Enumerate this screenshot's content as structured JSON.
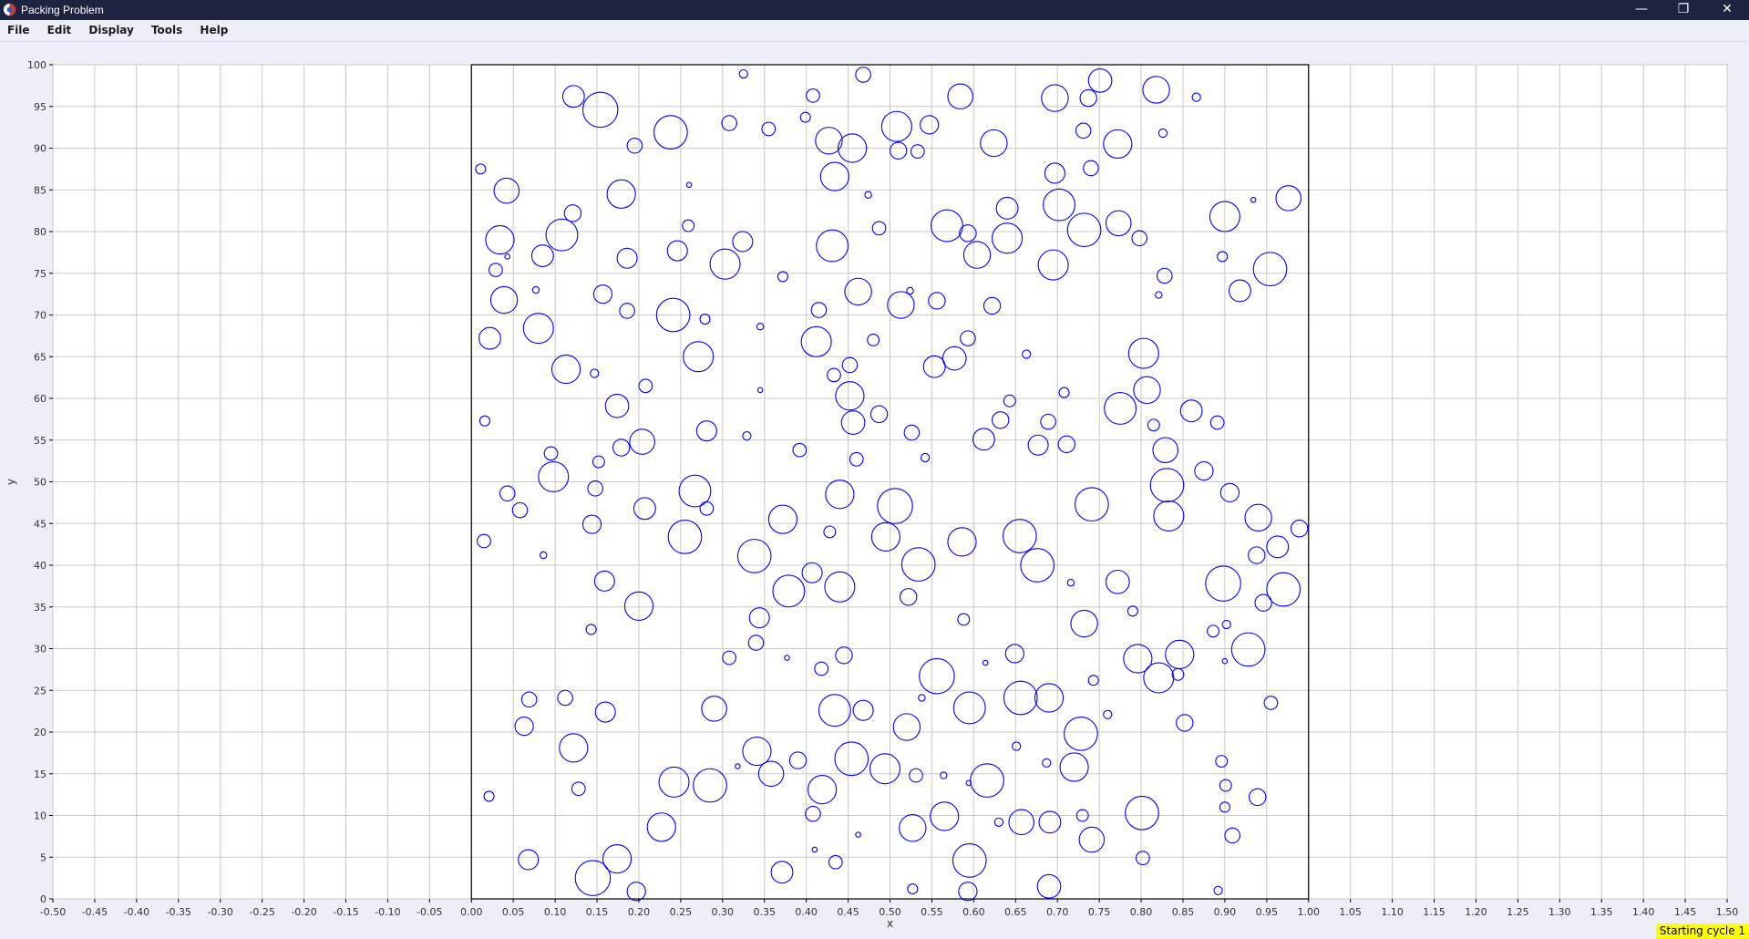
{
  "window": {
    "title": "Packing Problem",
    "minimize_label": "—",
    "restore_label": "❐",
    "close_label": "✕",
    "titlebar_color": "#1c2440"
  },
  "menu": {
    "file": "File",
    "edit": "Edit",
    "display": "Display",
    "tools": "Tools",
    "help": "Help"
  },
  "status": {
    "text": "Starting cycle 1"
  },
  "chart_data": {
    "type": "scatter",
    "xlabel": "x",
    "ylabel": "y",
    "xlim": [
      -0.5,
      1.5
    ],
    "ylim": [
      0,
      100
    ],
    "x_tick_step": 0.05,
    "y_tick_step": 5,
    "grid": true,
    "circle_color": "#0000ff",
    "container": {
      "x0": 0.0,
      "x1": 1.0,
      "y0": 0,
      "y1": 100
    },
    "circles": [
      {
        "x": 0.011,
        "y": 87.5,
        "r": 0.6
      },
      {
        "x": 0.042,
        "y": 84.9,
        "r": 1.5
      },
      {
        "x": 0.034,
        "y": 79,
        "r": 1.7
      },
      {
        "x": 0.043,
        "y": 77,
        "r": 0.3
      },
      {
        "x": 0.029,
        "y": 75.4,
        "r": 0.8
      },
      {
        "x": 0.039,
        "y": 71.8,
        "r": 1.6
      },
      {
        "x": 0.022,
        "y": 67.2,
        "r": 1.3
      },
      {
        "x": 0.016,
        "y": 57.3,
        "r": 0.6
      },
      {
        "x": 0.043,
        "y": 48.6,
        "r": 0.9
      },
      {
        "x": 0.058,
        "y": 46.6,
        "r": 0.9
      },
      {
        "x": 0.015,
        "y": 42.9,
        "r": 0.8
      },
      {
        "x": 0.021,
        "y": 12.3,
        "r": 0.6
      },
      {
        "x": 0.069,
        "y": 23.9,
        "r": 0.9
      },
      {
        "x": 0.063,
        "y": 20.7,
        "r": 1.1
      },
      {
        "x": 0.068,
        "y": 4.7,
        "r": 1.2
      },
      {
        "x": 0.122,
        "y": 96.2,
        "r": 1.3
      },
      {
        "x": 0.154,
        "y": 94.6,
        "r": 2.1
      },
      {
        "x": 0.121,
        "y": 82.2,
        "r": 1.0
      },
      {
        "x": 0.108,
        "y": 79.6,
        "r": 1.9
      },
      {
        "x": 0.085,
        "y": 77.1,
        "r": 1.3
      },
      {
        "x": 0.077,
        "y": 73,
        "r": 0.4
      },
      {
        "x": 0.08,
        "y": 68.4,
        "r": 1.8
      },
      {
        "x": 0.113,
        "y": 63.5,
        "r": 1.7
      },
      {
        "x": 0.147,
        "y": 63,
        "r": 0.5
      },
      {
        "x": 0.095,
        "y": 53.4,
        "r": 0.8
      },
      {
        "x": 0.098,
        "y": 50.6,
        "r": 1.8
      },
      {
        "x": 0.086,
        "y": 41.2,
        "r": 0.4
      },
      {
        "x": 0.148,
        "y": 49.2,
        "r": 0.9
      },
      {
        "x": 0.144,
        "y": 44.9,
        "r": 1.1
      },
      {
        "x": 0.143,
        "y": 32.3,
        "r": 0.6
      },
      {
        "x": 0.112,
        "y": 24.1,
        "r": 0.9
      },
      {
        "x": 0.122,
        "y": 18.1,
        "r": 1.7
      },
      {
        "x": 0.128,
        "y": 13.2,
        "r": 0.8
      },
      {
        "x": 0.145,
        "y": 2.5,
        "r": 2.1
      },
      {
        "x": 0.195,
        "y": 90.3,
        "r": 0.9
      },
      {
        "x": 0.179,
        "y": 84.5,
        "r": 1.7
      },
      {
        "x": 0.186,
        "y": 76.8,
        "r": 1.2
      },
      {
        "x": 0.157,
        "y": 72.5,
        "r": 1.1
      },
      {
        "x": 0.186,
        "y": 70.5,
        "r": 0.9
      },
      {
        "x": 0.208,
        "y": 61.5,
        "r": 0.8
      },
      {
        "x": 0.174,
        "y": 59.1,
        "r": 1.4
      },
      {
        "x": 0.179,
        "y": 54.1,
        "r": 1.0
      },
      {
        "x": 0.152,
        "y": 52.4,
        "r": 0.7
      },
      {
        "x": 0.204,
        "y": 54.8,
        "r": 1.5
      },
      {
        "x": 0.207,
        "y": 46.8,
        "r": 1.3
      },
      {
        "x": 0.159,
        "y": 38.1,
        "r": 1.2
      },
      {
        "x": 0.2,
        "y": 35.1,
        "r": 1.7
      },
      {
        "x": 0.16,
        "y": 22.4,
        "r": 1.2
      },
      {
        "x": 0.174,
        "y": 4.8,
        "r": 1.7
      },
      {
        "x": 0.197,
        "y": 0.9,
        "r": 1.1
      },
      {
        "x": 0.325,
        "y": 98.9,
        "r": 0.5
      },
      {
        "x": 0.238,
        "y": 91.9,
        "r": 2.0
      },
      {
        "x": 0.308,
        "y": 93,
        "r": 0.9
      },
      {
        "x": 0.355,
        "y": 92.3,
        "r": 0.8
      },
      {
        "x": 0.26,
        "y": 85.6,
        "r": 0.3
      },
      {
        "x": 0.259,
        "y": 80.7,
        "r": 0.7
      },
      {
        "x": 0.246,
        "y": 77.7,
        "r": 1.2
      },
      {
        "x": 0.303,
        "y": 76.1,
        "r": 1.8
      },
      {
        "x": 0.324,
        "y": 78.8,
        "r": 1.2
      },
      {
        "x": 0.241,
        "y": 70,
        "r": 2.0
      },
      {
        "x": 0.279,
        "y": 69.5,
        "r": 0.6
      },
      {
        "x": 0.271,
        "y": 65,
        "r": 1.8
      },
      {
        "x": 0.345,
        "y": 68.6,
        "r": 0.4
      },
      {
        "x": 0.345,
        "y": 61,
        "r": 0.3
      },
      {
        "x": 0.281,
        "y": 56.1,
        "r": 1.2
      },
      {
        "x": 0.329,
        "y": 55.5,
        "r": 0.5
      },
      {
        "x": 0.267,
        "y": 48.9,
        "r": 1.9
      },
      {
        "x": 0.281,
        "y": 46.8,
        "r": 0.8
      },
      {
        "x": 0.255,
        "y": 43.4,
        "r": 2.0
      },
      {
        "x": 0.338,
        "y": 41.1,
        "r": 2.0
      },
      {
        "x": 0.344,
        "y": 33.7,
        "r": 1.2
      },
      {
        "x": 0.34,
        "y": 30.7,
        "r": 0.9
      },
      {
        "x": 0.308,
        "y": 28.9,
        "r": 0.8
      },
      {
        "x": 0.29,
        "y": 22.8,
        "r": 1.5
      },
      {
        "x": 0.318,
        "y": 15.9,
        "r": 0.3
      },
      {
        "x": 0.341,
        "y": 17.7,
        "r": 1.7
      },
      {
        "x": 0.358,
        "y": 15,
        "r": 1.5
      },
      {
        "x": 0.285,
        "y": 13.6,
        "r": 2.0
      },
      {
        "x": 0.242,
        "y": 14,
        "r": 1.8
      },
      {
        "x": 0.227,
        "y": 8.6,
        "r": 1.7
      },
      {
        "x": 0.371,
        "y": 3.2,
        "r": 1.3
      },
      {
        "x": 0.468,
        "y": 98.8,
        "r": 0.9
      },
      {
        "x": 0.408,
        "y": 96.3,
        "r": 0.8
      },
      {
        "x": 0.399,
        "y": 93.7,
        "r": 0.6
      },
      {
        "x": 0.508,
        "y": 92.6,
        "r": 1.8
      },
      {
        "x": 0.427,
        "y": 90.9,
        "r": 1.6
      },
      {
        "x": 0.455,
        "y": 90,
        "r": 1.7
      },
      {
        "x": 0.51,
        "y": 89.7,
        "r": 1.0
      },
      {
        "x": 0.533,
        "y": 89.6,
        "r": 0.8
      },
      {
        "x": 0.547,
        "y": 92.8,
        "r": 1.1
      },
      {
        "x": 0.584,
        "y": 96.2,
        "r": 1.5
      },
      {
        "x": 0.434,
        "y": 86.6,
        "r": 1.7
      },
      {
        "x": 0.474,
        "y": 84.4,
        "r": 0.4
      },
      {
        "x": 0.487,
        "y": 80.4,
        "r": 0.8
      },
      {
        "x": 0.431,
        "y": 78.3,
        "r": 1.9
      },
      {
        "x": 0.372,
        "y": 74.6,
        "r": 0.6
      },
      {
        "x": 0.462,
        "y": 72.8,
        "r": 1.6
      },
      {
        "x": 0.415,
        "y": 70.6,
        "r": 0.9
      },
      {
        "x": 0.412,
        "y": 66.8,
        "r": 1.8
      },
      {
        "x": 0.48,
        "y": 67,
        "r": 0.7
      },
      {
        "x": 0.524,
        "y": 72.9,
        "r": 0.4
      },
      {
        "x": 0.513,
        "y": 71.2,
        "r": 1.6
      },
      {
        "x": 0.556,
        "y": 71.7,
        "r": 1.0
      },
      {
        "x": 0.568,
        "y": 80.7,
        "r": 1.9
      },
      {
        "x": 0.593,
        "y": 79.8,
        "r": 1.0
      },
      {
        "x": 0.452,
        "y": 64,
        "r": 0.9
      },
      {
        "x": 0.433,
        "y": 62.8,
        "r": 0.8
      },
      {
        "x": 0.452,
        "y": 60.3,
        "r": 1.7
      },
      {
        "x": 0.456,
        "y": 57.1,
        "r": 1.4
      },
      {
        "x": 0.487,
        "y": 58.1,
        "r": 1.0
      },
      {
        "x": 0.392,
        "y": 53.8,
        "r": 0.8
      },
      {
        "x": 0.46,
        "y": 52.7,
        "r": 0.8
      },
      {
        "x": 0.44,
        "y": 48.5,
        "r": 1.7
      },
      {
        "x": 0.372,
        "y": 45.5,
        "r": 1.7
      },
      {
        "x": 0.428,
        "y": 44,
        "r": 0.7
      },
      {
        "x": 0.407,
        "y": 39.1,
        "r": 1.2
      },
      {
        "x": 0.379,
        "y": 36.9,
        "r": 1.9
      },
      {
        "x": 0.44,
        "y": 37.4,
        "r": 1.8
      },
      {
        "x": 0.377,
        "y": 28.9,
        "r": 0.3
      },
      {
        "x": 0.445,
        "y": 29.2,
        "r": 1.0
      },
      {
        "x": 0.418,
        "y": 27.6,
        "r": 0.8
      },
      {
        "x": 0.434,
        "y": 22.6,
        "r": 1.9
      },
      {
        "x": 0.468,
        "y": 22.6,
        "r": 1.2
      },
      {
        "x": 0.39,
        "y": 16.6,
        "r": 1.0
      },
      {
        "x": 0.454,
        "y": 16.8,
        "r": 2.0
      },
      {
        "x": 0.419,
        "y": 13.1,
        "r": 1.7
      },
      {
        "x": 0.408,
        "y": 10.2,
        "r": 0.9
      },
      {
        "x": 0.41,
        "y": 5.9,
        "r": 0.3
      },
      {
        "x": 0.462,
        "y": 7.7,
        "r": 0.3
      },
      {
        "x": 0.435,
        "y": 4.4,
        "r": 0.8
      },
      {
        "x": 0.506,
        "y": 47.1,
        "r": 2.1
      },
      {
        "x": 0.495,
        "y": 43.4,
        "r": 1.7
      },
      {
        "x": 0.526,
        "y": 55.9,
        "r": 0.9
      },
      {
        "x": 0.542,
        "y": 52.9,
        "r": 0.5
      },
      {
        "x": 0.553,
        "y": 63.8,
        "r": 1.3
      },
      {
        "x": 0.577,
        "y": 64.8,
        "r": 1.4
      },
      {
        "x": 0.593,
        "y": 67.2,
        "r": 0.9
      },
      {
        "x": 0.604,
        "y": 77.2,
        "r": 1.6
      },
      {
        "x": 0.624,
        "y": 90.6,
        "r": 1.6
      },
      {
        "x": 0.64,
        "y": 82.8,
        "r": 1.3
      },
      {
        "x": 0.64,
        "y": 79.2,
        "r": 1.8
      },
      {
        "x": 0.622,
        "y": 71.1,
        "r": 1.0
      },
      {
        "x": 0.534,
        "y": 40.1,
        "r": 2.0
      },
      {
        "x": 0.586,
        "y": 42.8,
        "r": 1.7
      },
      {
        "x": 0.522,
        "y": 36.2,
        "r": 1.0
      },
      {
        "x": 0.588,
        "y": 33.5,
        "r": 0.7
      },
      {
        "x": 0.614,
        "y": 28.3,
        "r": 0.3
      },
      {
        "x": 0.538,
        "y": 24.1,
        "r": 0.4
      },
      {
        "x": 0.556,
        "y": 26.7,
        "r": 2.1
      },
      {
        "x": 0.52,
        "y": 20.6,
        "r": 1.6
      },
      {
        "x": 0.595,
        "y": 22.9,
        "r": 1.9
      },
      {
        "x": 0.494,
        "y": 15.6,
        "r": 1.8
      },
      {
        "x": 0.531,
        "y": 14.8,
        "r": 0.8
      },
      {
        "x": 0.564,
        "y": 14.8,
        "r": 0.4
      },
      {
        "x": 0.527,
        "y": 8.5,
        "r": 1.6
      },
      {
        "x": 0.565,
        "y": 9.9,
        "r": 1.7
      },
      {
        "x": 0.616,
        "y": 14.2,
        "r": 2.0
      },
      {
        "x": 0.594,
        "y": 13.9,
        "r": 0.3
      },
      {
        "x": 0.527,
        "y": 1.2,
        "r": 0.6
      },
      {
        "x": 0.595,
        "y": 4.6,
        "r": 2.0
      },
      {
        "x": 0.593,
        "y": 0.9,
        "r": 1.1
      },
      {
        "x": 0.612,
        "y": 55.1,
        "r": 1.3
      },
      {
        "x": 0.632,
        "y": 57.4,
        "r": 1.0
      },
      {
        "x": 0.643,
        "y": 59.7,
        "r": 0.7
      },
      {
        "x": 0.663,
        "y": 65.3,
        "r": 0.5
      },
      {
        "x": 0.697,
        "y": 96,
        "r": 1.6
      },
      {
        "x": 0.737,
        "y": 96,
        "r": 1.0
      },
      {
        "x": 0.751,
        "y": 98.1,
        "r": 1.4
      },
      {
        "x": 0.818,
        "y": 97,
        "r": 1.6
      },
      {
        "x": 0.866,
        "y": 96.1,
        "r": 0.5
      },
      {
        "x": 0.731,
        "y": 92.1,
        "r": 0.9
      },
      {
        "x": 0.772,
        "y": 90.5,
        "r": 1.7
      },
      {
        "x": 0.826,
        "y": 91.8,
        "r": 0.5
      },
      {
        "x": 0.697,
        "y": 87,
        "r": 1.2
      },
      {
        "x": 0.74,
        "y": 87.6,
        "r": 0.9
      },
      {
        "x": 0.702,
        "y": 83.2,
        "r": 1.9
      },
      {
        "x": 0.732,
        "y": 80.2,
        "r": 2.0
      },
      {
        "x": 0.773,
        "y": 81,
        "r": 1.5
      },
      {
        "x": 0.798,
        "y": 79.2,
        "r": 0.9
      },
      {
        "x": 0.695,
        "y": 76,
        "r": 1.8
      },
      {
        "x": 0.828,
        "y": 74.7,
        "r": 0.9
      },
      {
        "x": 0.821,
        "y": 72.4,
        "r": 0.4
      },
      {
        "x": 0.803,
        "y": 65.4,
        "r": 1.8
      },
      {
        "x": 0.807,
        "y": 61,
        "r": 1.6
      },
      {
        "x": 0.708,
        "y": 60.7,
        "r": 0.6
      },
      {
        "x": 0.775,
        "y": 58.8,
        "r": 1.9
      },
      {
        "x": 0.815,
        "y": 56.8,
        "r": 0.7
      },
      {
        "x": 0.689,
        "y": 57.2,
        "r": 0.9
      },
      {
        "x": 0.677,
        "y": 54.4,
        "r": 1.2
      },
      {
        "x": 0.711,
        "y": 54.5,
        "r": 1.0
      },
      {
        "x": 0.829,
        "y": 53.8,
        "r": 1.5
      },
      {
        "x": 0.831,
        "y": 49.6,
        "r": 2.0
      },
      {
        "x": 0.833,
        "y": 45.9,
        "r": 1.8
      },
      {
        "x": 0.741,
        "y": 47.3,
        "r": 2.0
      },
      {
        "x": 0.655,
        "y": 43.5,
        "r": 2.0
      },
      {
        "x": 0.676,
        "y": 40,
        "r": 2.0
      },
      {
        "x": 0.716,
        "y": 37.9,
        "r": 0.4
      },
      {
        "x": 0.772,
        "y": 38,
        "r": 1.4
      },
      {
        "x": 0.79,
        "y": 34.5,
        "r": 0.6
      },
      {
        "x": 0.732,
        "y": 33,
        "r": 1.6
      },
      {
        "x": 0.649,
        "y": 29.4,
        "r": 1.1
      },
      {
        "x": 0.796,
        "y": 28.8,
        "r": 1.7
      },
      {
        "x": 0.821,
        "y": 26.5,
        "r": 1.8
      },
      {
        "x": 0.846,
        "y": 29.3,
        "r": 1.7
      },
      {
        "x": 0.844,
        "y": 26.9,
        "r": 0.7
      },
      {
        "x": 0.743,
        "y": 26.2,
        "r": 0.6
      },
      {
        "x": 0.656,
        "y": 24.1,
        "r": 2.0
      },
      {
        "x": 0.69,
        "y": 24.1,
        "r": 1.7
      },
      {
        "x": 0.76,
        "y": 22.1,
        "r": 0.5
      },
      {
        "x": 0.728,
        "y": 19.8,
        "r": 2.0
      },
      {
        "x": 0.72,
        "y": 15.8,
        "r": 1.7
      },
      {
        "x": 0.651,
        "y": 18.3,
        "r": 0.5
      },
      {
        "x": 0.687,
        "y": 16.3,
        "r": 0.5
      },
      {
        "x": 0.852,
        "y": 21.1,
        "r": 1.0
      },
      {
        "x": 0.801,
        "y": 10.3,
        "r": 2.0
      },
      {
        "x": 0.657,
        "y": 9.2,
        "r": 1.5
      },
      {
        "x": 0.63,
        "y": 9.2,
        "r": 0.5
      },
      {
        "x": 0.691,
        "y": 9.2,
        "r": 1.3
      },
      {
        "x": 0.73,
        "y": 10,
        "r": 0.7
      },
      {
        "x": 0.741,
        "y": 7.1,
        "r": 1.5
      },
      {
        "x": 0.802,
        "y": 4.9,
        "r": 0.8
      },
      {
        "x": 0.69,
        "y": 1.5,
        "r": 1.4
      },
      {
        "x": 0.934,
        "y": 83.8,
        "r": 0.3
      },
      {
        "x": 0.976,
        "y": 84,
        "r": 1.5
      },
      {
        "x": 0.9,
        "y": 81.8,
        "r": 1.8
      },
      {
        "x": 0.897,
        "y": 77,
        "r": 0.6
      },
      {
        "x": 0.954,
        "y": 75.5,
        "r": 2.0
      },
      {
        "x": 0.918,
        "y": 72.9,
        "r": 1.3
      },
      {
        "x": 0.86,
        "y": 58.5,
        "r": 1.3
      },
      {
        "x": 0.891,
        "y": 57.1,
        "r": 0.8
      },
      {
        "x": 0.875,
        "y": 51.3,
        "r": 1.1
      },
      {
        "x": 0.906,
        "y": 48.7,
        "r": 1.1
      },
      {
        "x": 0.94,
        "y": 45.7,
        "r": 1.6
      },
      {
        "x": 0.989,
        "y": 44.4,
        "r": 1.0
      },
      {
        "x": 0.963,
        "y": 42.2,
        "r": 1.3
      },
      {
        "x": 0.938,
        "y": 41.2,
        "r": 1.0
      },
      {
        "x": 0.898,
        "y": 37.8,
        "r": 2.1
      },
      {
        "x": 0.97,
        "y": 37.1,
        "r": 2.0
      },
      {
        "x": 0.946,
        "y": 35.5,
        "r": 1.0
      },
      {
        "x": 0.902,
        "y": 32.9,
        "r": 0.5
      },
      {
        "x": 0.886,
        "y": 32.1,
        "r": 0.7
      },
      {
        "x": 0.928,
        "y": 29.9,
        "r": 2.0
      },
      {
        "x": 0.9,
        "y": 28.5,
        "r": 0.3
      },
      {
        "x": 0.955,
        "y": 23.5,
        "r": 0.8
      },
      {
        "x": 0.896,
        "y": 16.5,
        "r": 0.7
      },
      {
        "x": 0.901,
        "y": 13.6,
        "r": 0.7
      },
      {
        "x": 0.9,
        "y": 11,
        "r": 0.6
      },
      {
        "x": 0.939,
        "y": 12.2,
        "r": 1.0
      },
      {
        "x": 0.909,
        "y": 7.6,
        "r": 0.9
      },
      {
        "x": 0.892,
        "y": 1,
        "r": 0.5
      }
    ]
  }
}
